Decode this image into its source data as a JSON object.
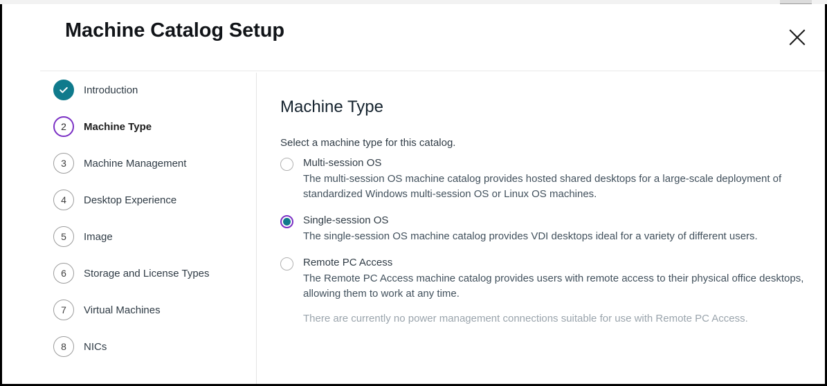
{
  "window": {
    "title": "Machine Catalog Setup",
    "close_icon": "close-x-icon"
  },
  "colors": {
    "accent_teal": "#0f7a8c",
    "accent_purple": "#7a2fc4",
    "text_primary": "#2f3b45",
    "text_muted": "#9aa4ac",
    "frame_border": "#000000"
  },
  "sidebar": {
    "steps": [
      {
        "number": "1",
        "marker": "check-icon",
        "label": "Introduction",
        "state": "done"
      },
      {
        "number": "2",
        "marker": "2",
        "label": "Machine Type",
        "state": "current"
      },
      {
        "number": "3",
        "marker": "3",
        "label": "Machine Management",
        "state": "todo"
      },
      {
        "number": "4",
        "marker": "4",
        "label": "Desktop Experience",
        "state": "todo"
      },
      {
        "number": "5",
        "marker": "5",
        "label": "Image",
        "state": "todo"
      },
      {
        "number": "6",
        "marker": "6",
        "label": "Storage and License Types",
        "state": "todo"
      },
      {
        "number": "7",
        "marker": "7",
        "label": "Virtual Machines",
        "state": "todo"
      },
      {
        "number": "8",
        "marker": "8",
        "label": "NICs",
        "state": "todo"
      }
    ]
  },
  "content": {
    "title": "Machine Type",
    "subtitle": "Select a machine type for this catalog.",
    "options": [
      {
        "label": "Multi-session OS",
        "description": "The multi-session OS machine catalog provides hosted shared desktops for a large-scale deployment of standardized Windows multi-session OS or Linux OS machines.",
        "selected": false
      },
      {
        "label": "Single-session OS",
        "description": "The single-session OS machine catalog provides VDI desktops ideal for a variety of different users.",
        "selected": true
      },
      {
        "label": "Remote PC Access",
        "description": "The Remote PC Access machine catalog provides users with remote access to their physical office desktops, allowing them to work at any time.",
        "note": "There are currently no power management connections suitable for use with Remote PC Access.",
        "selected": false
      }
    ]
  }
}
